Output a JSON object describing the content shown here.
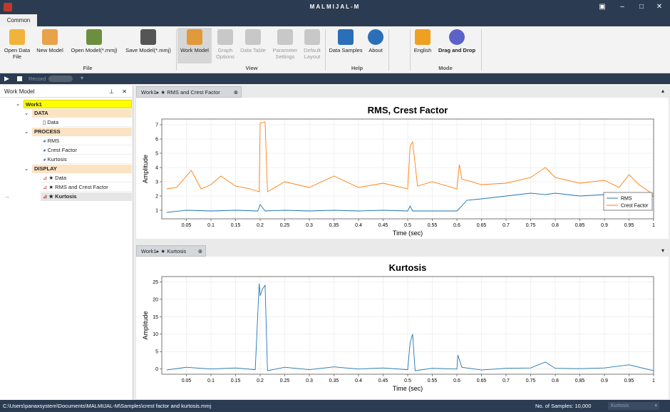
{
  "app": {
    "title": "MALMIJAL-M"
  },
  "tabs": {
    "common": "Common"
  },
  "ribbon": {
    "open_data": "Open Data File",
    "new_model": "New Model",
    "open_model": "Open Model(*.mmj)",
    "save_model": "Save Model(*.mmj)",
    "work_model": "Work Model",
    "graph_options": "Graph Options",
    "data_table": "Data Table",
    "parameter_settings": "Parameter Settings",
    "default_layout": "Default Layout",
    "data_samples": "Data Samples",
    "about": "About",
    "english": "English",
    "drag_drop": "Drag and Drop",
    "groups": {
      "file": "File",
      "view": "View",
      "help": "Help",
      "mode": "Mode"
    }
  },
  "toolbar": {
    "record": "Record"
  },
  "work_model": {
    "title": "Work Model",
    "root": "Work1",
    "sections": {
      "data": "DATA",
      "process": "PROCESS",
      "display": "DISPLAY"
    },
    "items": {
      "data": "Data",
      "rms": "RMS",
      "crest": "Crest Factor",
      "kurtosis": "Kurtosis",
      "disp_data": "★ Data",
      "disp_rms_crest": "★ RMS and Crest Factor",
      "disp_kurtosis": "★ Kurtosis"
    }
  },
  "doc_tabs": {
    "top": "Work1▸ ★ RMS and Crest Factor",
    "bottom": "Work1▸ ★ Kurtosis"
  },
  "status": {
    "path": "C:\\Users\\panaxsystem\\Documents\\MALMIJAL-M\\Samples\\crest factor and kurtosis.mmj",
    "samples": "No. of Samples: 10,000",
    "combo": "Kurtosis"
  },
  "chart_data": [
    {
      "type": "line",
      "title": "RMS, Crest Factor",
      "xlabel": "Time (sec)",
      "ylabel": "Amplitude",
      "xlim": [
        0,
        1
      ],
      "ylim": [
        0.4,
        7.4
      ],
      "xticks": [
        "0.05",
        "0.1",
        "0.15",
        "0.2",
        "0.25",
        "0.3",
        "0.35",
        "0.4",
        "0.45",
        "0.5",
        "0.55",
        "0.6",
        "0.65",
        "0.7",
        "0.75",
        "0.8",
        "0.85",
        "0.9",
        "0.95",
        "1"
      ],
      "yticks": [
        "1",
        "2",
        "3",
        "4",
        "5",
        "6",
        "7"
      ],
      "legend": "bottom-right",
      "series": [
        {
          "name": "RMS",
          "color": "#1f77b4",
          "x": [
            0.01,
            0.05,
            0.1,
            0.15,
            0.195,
            0.2,
            0.21,
            0.25,
            0.3,
            0.35,
            0.4,
            0.45,
            0.5,
            0.505,
            0.51,
            0.55,
            0.6,
            0.61,
            0.62,
            0.65,
            0.7,
            0.75,
            0.78,
            0.8,
            0.85,
            0.9,
            0.95,
            1.0
          ],
          "values": [
            0.85,
            1.0,
            0.95,
            1.0,
            0.95,
            1.4,
            0.95,
            1.0,
            0.95,
            1.0,
            0.95,
            1.0,
            0.95,
            1.3,
            0.95,
            0.95,
            0.95,
            1.3,
            1.7,
            1.8,
            2.0,
            2.2,
            2.1,
            2.2,
            2.0,
            2.1,
            1.9,
            2.0
          ]
        },
        {
          "name": "Crest Factor",
          "color": "#ff7f0e",
          "x": [
            0.01,
            0.03,
            0.06,
            0.08,
            0.1,
            0.12,
            0.15,
            0.18,
            0.198,
            0.2,
            0.21,
            0.215,
            0.25,
            0.3,
            0.35,
            0.4,
            0.45,
            0.5,
            0.505,
            0.51,
            0.52,
            0.55,
            0.6,
            0.605,
            0.61,
            0.65,
            0.7,
            0.75,
            0.78,
            0.8,
            0.85,
            0.9,
            0.93,
            0.95,
            0.97,
            1.0
          ],
          "values": [
            2.5,
            2.6,
            3.8,
            2.5,
            2.8,
            3.4,
            2.7,
            2.5,
            2.3,
            7.1,
            7.2,
            2.3,
            3.0,
            2.6,
            3.4,
            2.6,
            2.9,
            2.5,
            5.5,
            5.8,
            2.7,
            3.0,
            2.5,
            4.2,
            3.2,
            2.8,
            2.9,
            3.3,
            4.0,
            3.3,
            2.9,
            3.1,
            2.6,
            3.5,
            2.8,
            2.1
          ]
        }
      ]
    },
    {
      "type": "line",
      "title": "Kurtosis",
      "xlabel": "Time (sec)",
      "ylabel": "Amplitude",
      "xlim": [
        0,
        1
      ],
      "ylim": [
        -1.5,
        26.5
      ],
      "xticks": [
        "0.05",
        "0.1",
        "0.15",
        "0.2",
        "0.25",
        "0.3",
        "0.35",
        "0.4",
        "0.45",
        "0.5",
        "0.55",
        "0.6",
        "0.65",
        "0.7",
        "0.75",
        "0.8",
        "0.85",
        "0.9",
        "0.95",
        "1"
      ],
      "yticks": [
        "0",
        "5",
        "10",
        "15",
        "20",
        "25"
      ],
      "series": [
        {
          "name": "Kurtosis",
          "color": "#1f77b4",
          "x": [
            0.01,
            0.05,
            0.1,
            0.15,
            0.19,
            0.198,
            0.2,
            0.205,
            0.21,
            0.215,
            0.25,
            0.3,
            0.35,
            0.4,
            0.45,
            0.5,
            0.505,
            0.51,
            0.515,
            0.55,
            0.6,
            0.602,
            0.61,
            0.65,
            0.7,
            0.75,
            0.78,
            0.8,
            0.85,
            0.9,
            0.95,
            1.0
          ],
          "values": [
            -0.3,
            0.5,
            0,
            0.3,
            -0.2,
            24.5,
            21,
            23,
            24,
            -0.5,
            0.5,
            -0.2,
            0.6,
            0,
            0.3,
            -0.2,
            7.5,
            10,
            -0.5,
            0.2,
            0,
            4,
            0.5,
            -0.3,
            0.2,
            0.3,
            2,
            0.2,
            0.1,
            0.3,
            1.2,
            -0.5
          ]
        }
      ]
    }
  ]
}
